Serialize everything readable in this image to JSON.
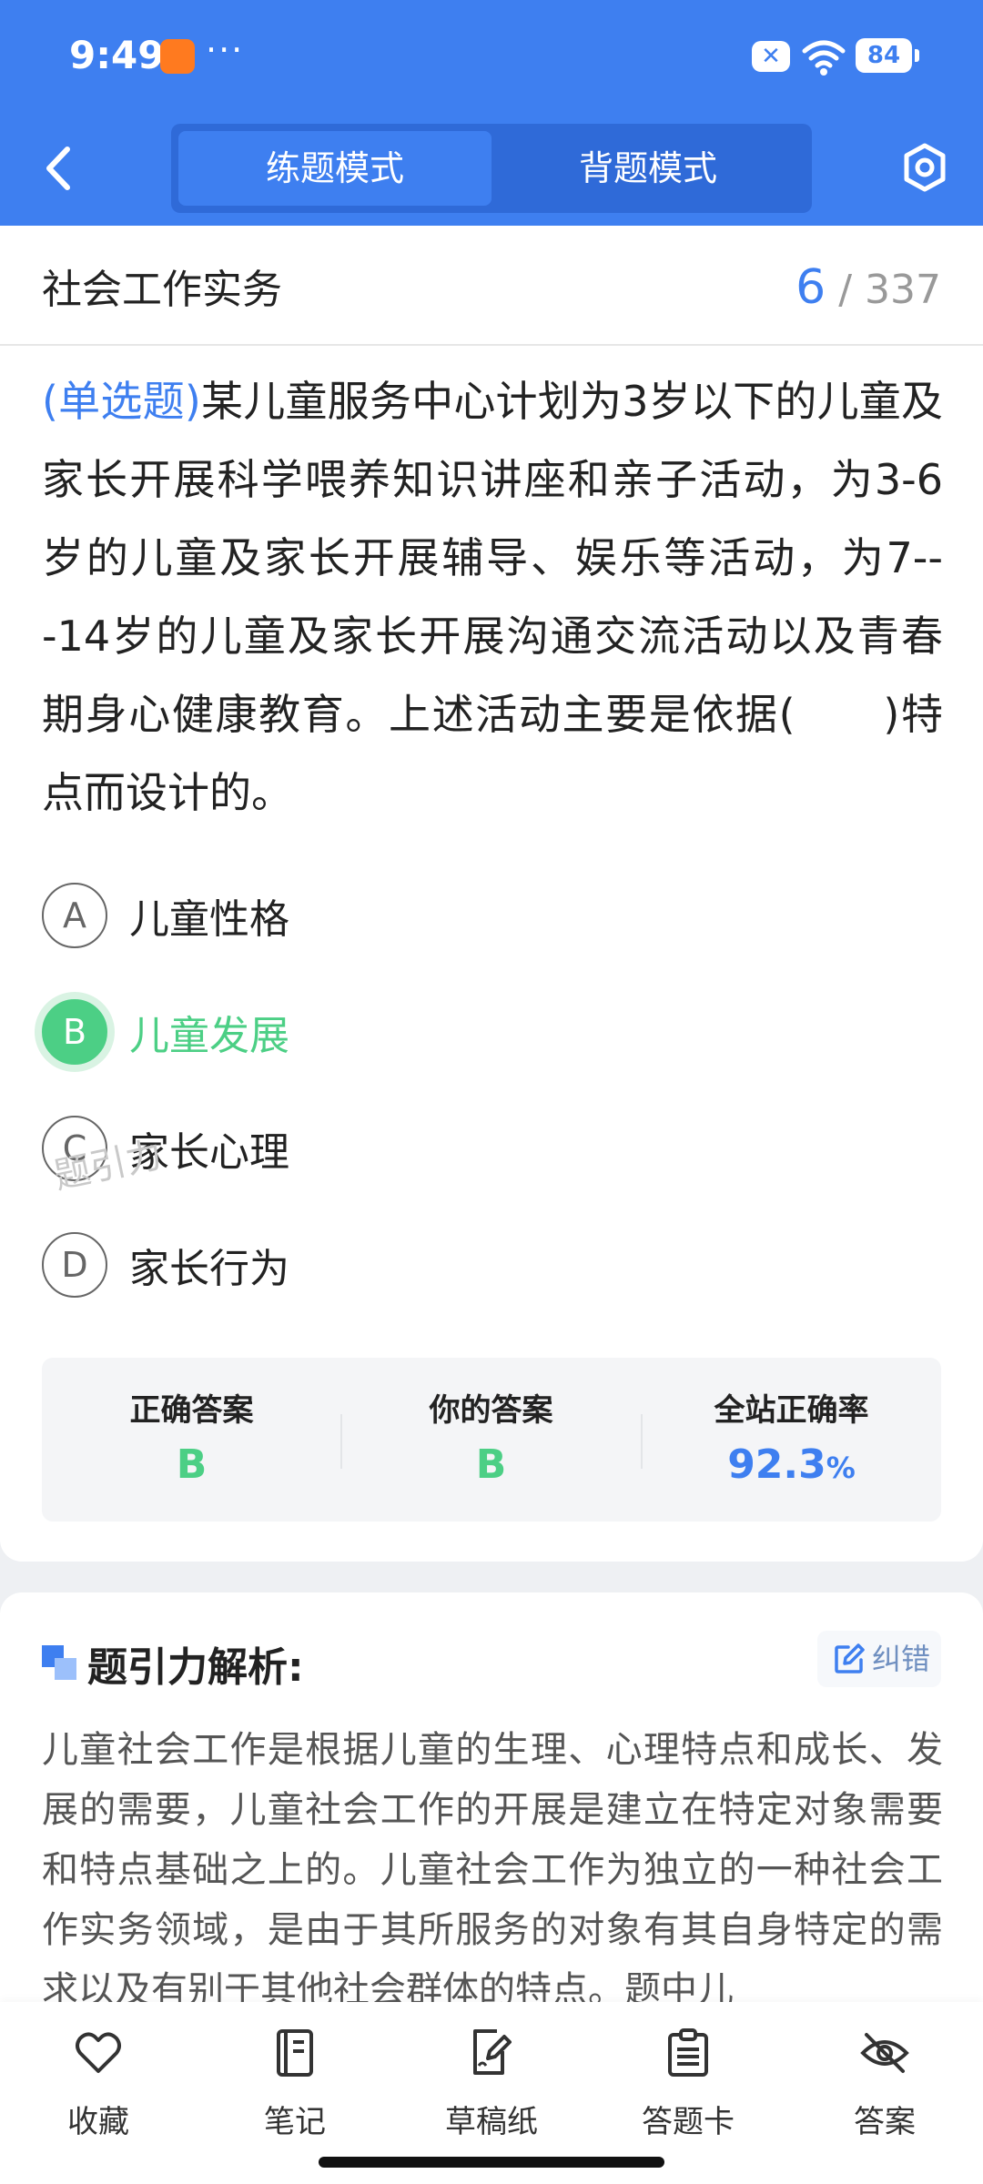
{
  "status_bar": {
    "time": "9:49",
    "dots": "···",
    "x_label": "✕",
    "battery": "84"
  },
  "header": {
    "tabs": [
      {
        "label": "练题模式",
        "active": true
      },
      {
        "label": "背题模式",
        "active": false
      }
    ]
  },
  "question": {
    "subject": "社会工作实务",
    "current": "6",
    "separator": " / ",
    "total": "337",
    "type_label": "(单选题)",
    "text": "某儿童服务中心计划为3岁以下的儿童及家长开展科学喂养知识讲座和亲子活动，为3-6岁的儿童及家长开展辅导、娱乐等活动，为7---14岁的儿童及家长开展沟通交流活动以及青春期身心健康教育。上述活动主要是依据(　　)特点而设计的。",
    "options": [
      {
        "letter": "A",
        "text": "儿童性格",
        "correct": false
      },
      {
        "letter": "B",
        "text": "儿童发展",
        "correct": true
      },
      {
        "letter": "C",
        "text": "家长心理",
        "correct": false
      },
      {
        "letter": "D",
        "text": "家长行为",
        "correct": false
      }
    ],
    "watermark": "题引力"
  },
  "stats": {
    "correct_answer_label": "正确答案",
    "correct_answer": "B",
    "your_answer_label": "你的答案",
    "your_answer": "B",
    "rate_label": "全站正确率",
    "rate_value": "92.3",
    "rate_unit": "%"
  },
  "analysis": {
    "title": "题引力解析:",
    "report_label": "纠错",
    "text": "儿童社会工作是根据儿童的生理、心理特点和成长、发展的需要，儿童社会工作的开展是建立在特定对象需要和特点基础之上的。儿童社会工作为独立的一种社会工作实务领域，是由于其所服务的对象有其自身特定的需求以及有别于其他社会群体的特点。题中儿"
  },
  "bottom_nav": [
    {
      "label": "收藏",
      "icon": "heart-icon"
    },
    {
      "label": "笔记",
      "icon": "notebook-icon"
    },
    {
      "label": "草稿纸",
      "icon": "draft-paper-icon"
    },
    {
      "label": "答题卡",
      "icon": "answer-card-icon"
    },
    {
      "label": "答案",
      "icon": "eye-off-icon"
    }
  ],
  "colors": {
    "primary": "#3e7ff0",
    "correct": "#4ccf85",
    "text": "#222222"
  }
}
